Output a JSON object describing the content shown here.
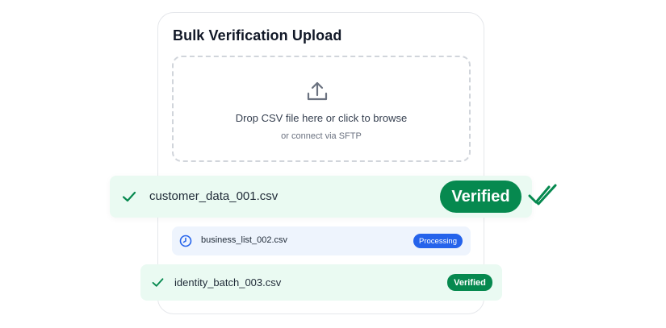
{
  "card": {
    "title": "Bulk Verification Upload"
  },
  "dropzone": {
    "icon": "upload-icon",
    "title": "Drop CSV file here or click to browse",
    "subtitle": "or connect via SFTP"
  },
  "files": [
    {
      "name": "customer_data_001.csv",
      "status": "Verified",
      "icon": "check-icon"
    },
    {
      "name": "business_list_002.csv",
      "status": "Processing",
      "icon": "clock-icon"
    },
    {
      "name": "identity_batch_003.csv",
      "status": "Verified",
      "icon": "check-icon"
    }
  ],
  "colors": {
    "success": "#06894f",
    "success_bg": "#eafaf2",
    "processing": "#2563eb",
    "processing_bg": "#eef4fd"
  }
}
